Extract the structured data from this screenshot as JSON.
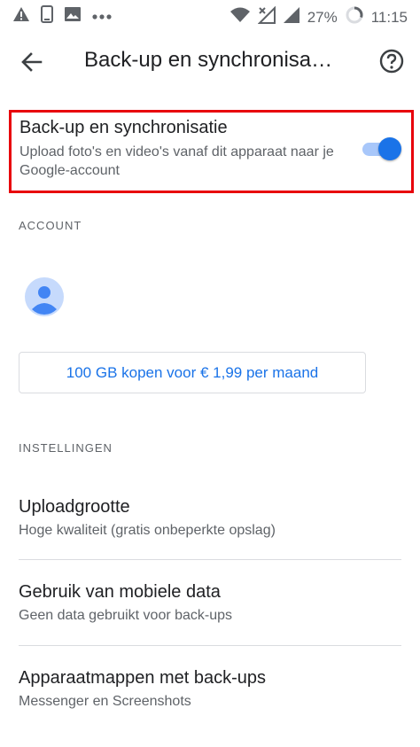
{
  "status_bar": {
    "battery_percent": "27%",
    "time": "11:15",
    "icons": [
      "warning-icon",
      "phone-icon",
      "image-icon",
      "more-dots-icon",
      "wifi-icon",
      "no-signal-icon",
      "signal-icon",
      "battery-circle-icon"
    ]
  },
  "app_bar": {
    "title": "Back-up en synchronisa…",
    "back_icon": "arrow-back-icon",
    "help_icon": "help-circle-icon"
  },
  "backup_sync": {
    "title": "Back-up en synchronisatie",
    "subtitle": "Upload foto's en video's vanaf dit apparaat naar je Google-account",
    "enabled": true
  },
  "account": {
    "header": "ACCOUNT",
    "avatar_icon": "person-avatar-icon",
    "buy_label": "100 GB kopen voor € 1,99 per maand"
  },
  "settings": {
    "header": "INSTELLINGEN",
    "items": [
      {
        "title": "Uploadgrootte",
        "subtitle": "Hoge kwaliteit (gratis onbeperkte opslag)"
      },
      {
        "title": "Gebruik van mobiele data",
        "subtitle": "Geen data gebruikt voor back-ups"
      },
      {
        "title": "Apparaatmappen met back-ups",
        "subtitle": "Messenger en Screenshots"
      }
    ]
  },
  "colors": {
    "accent": "#1a73e8",
    "highlight_border": "#e8000b",
    "secondary_text": "#5f6368"
  }
}
